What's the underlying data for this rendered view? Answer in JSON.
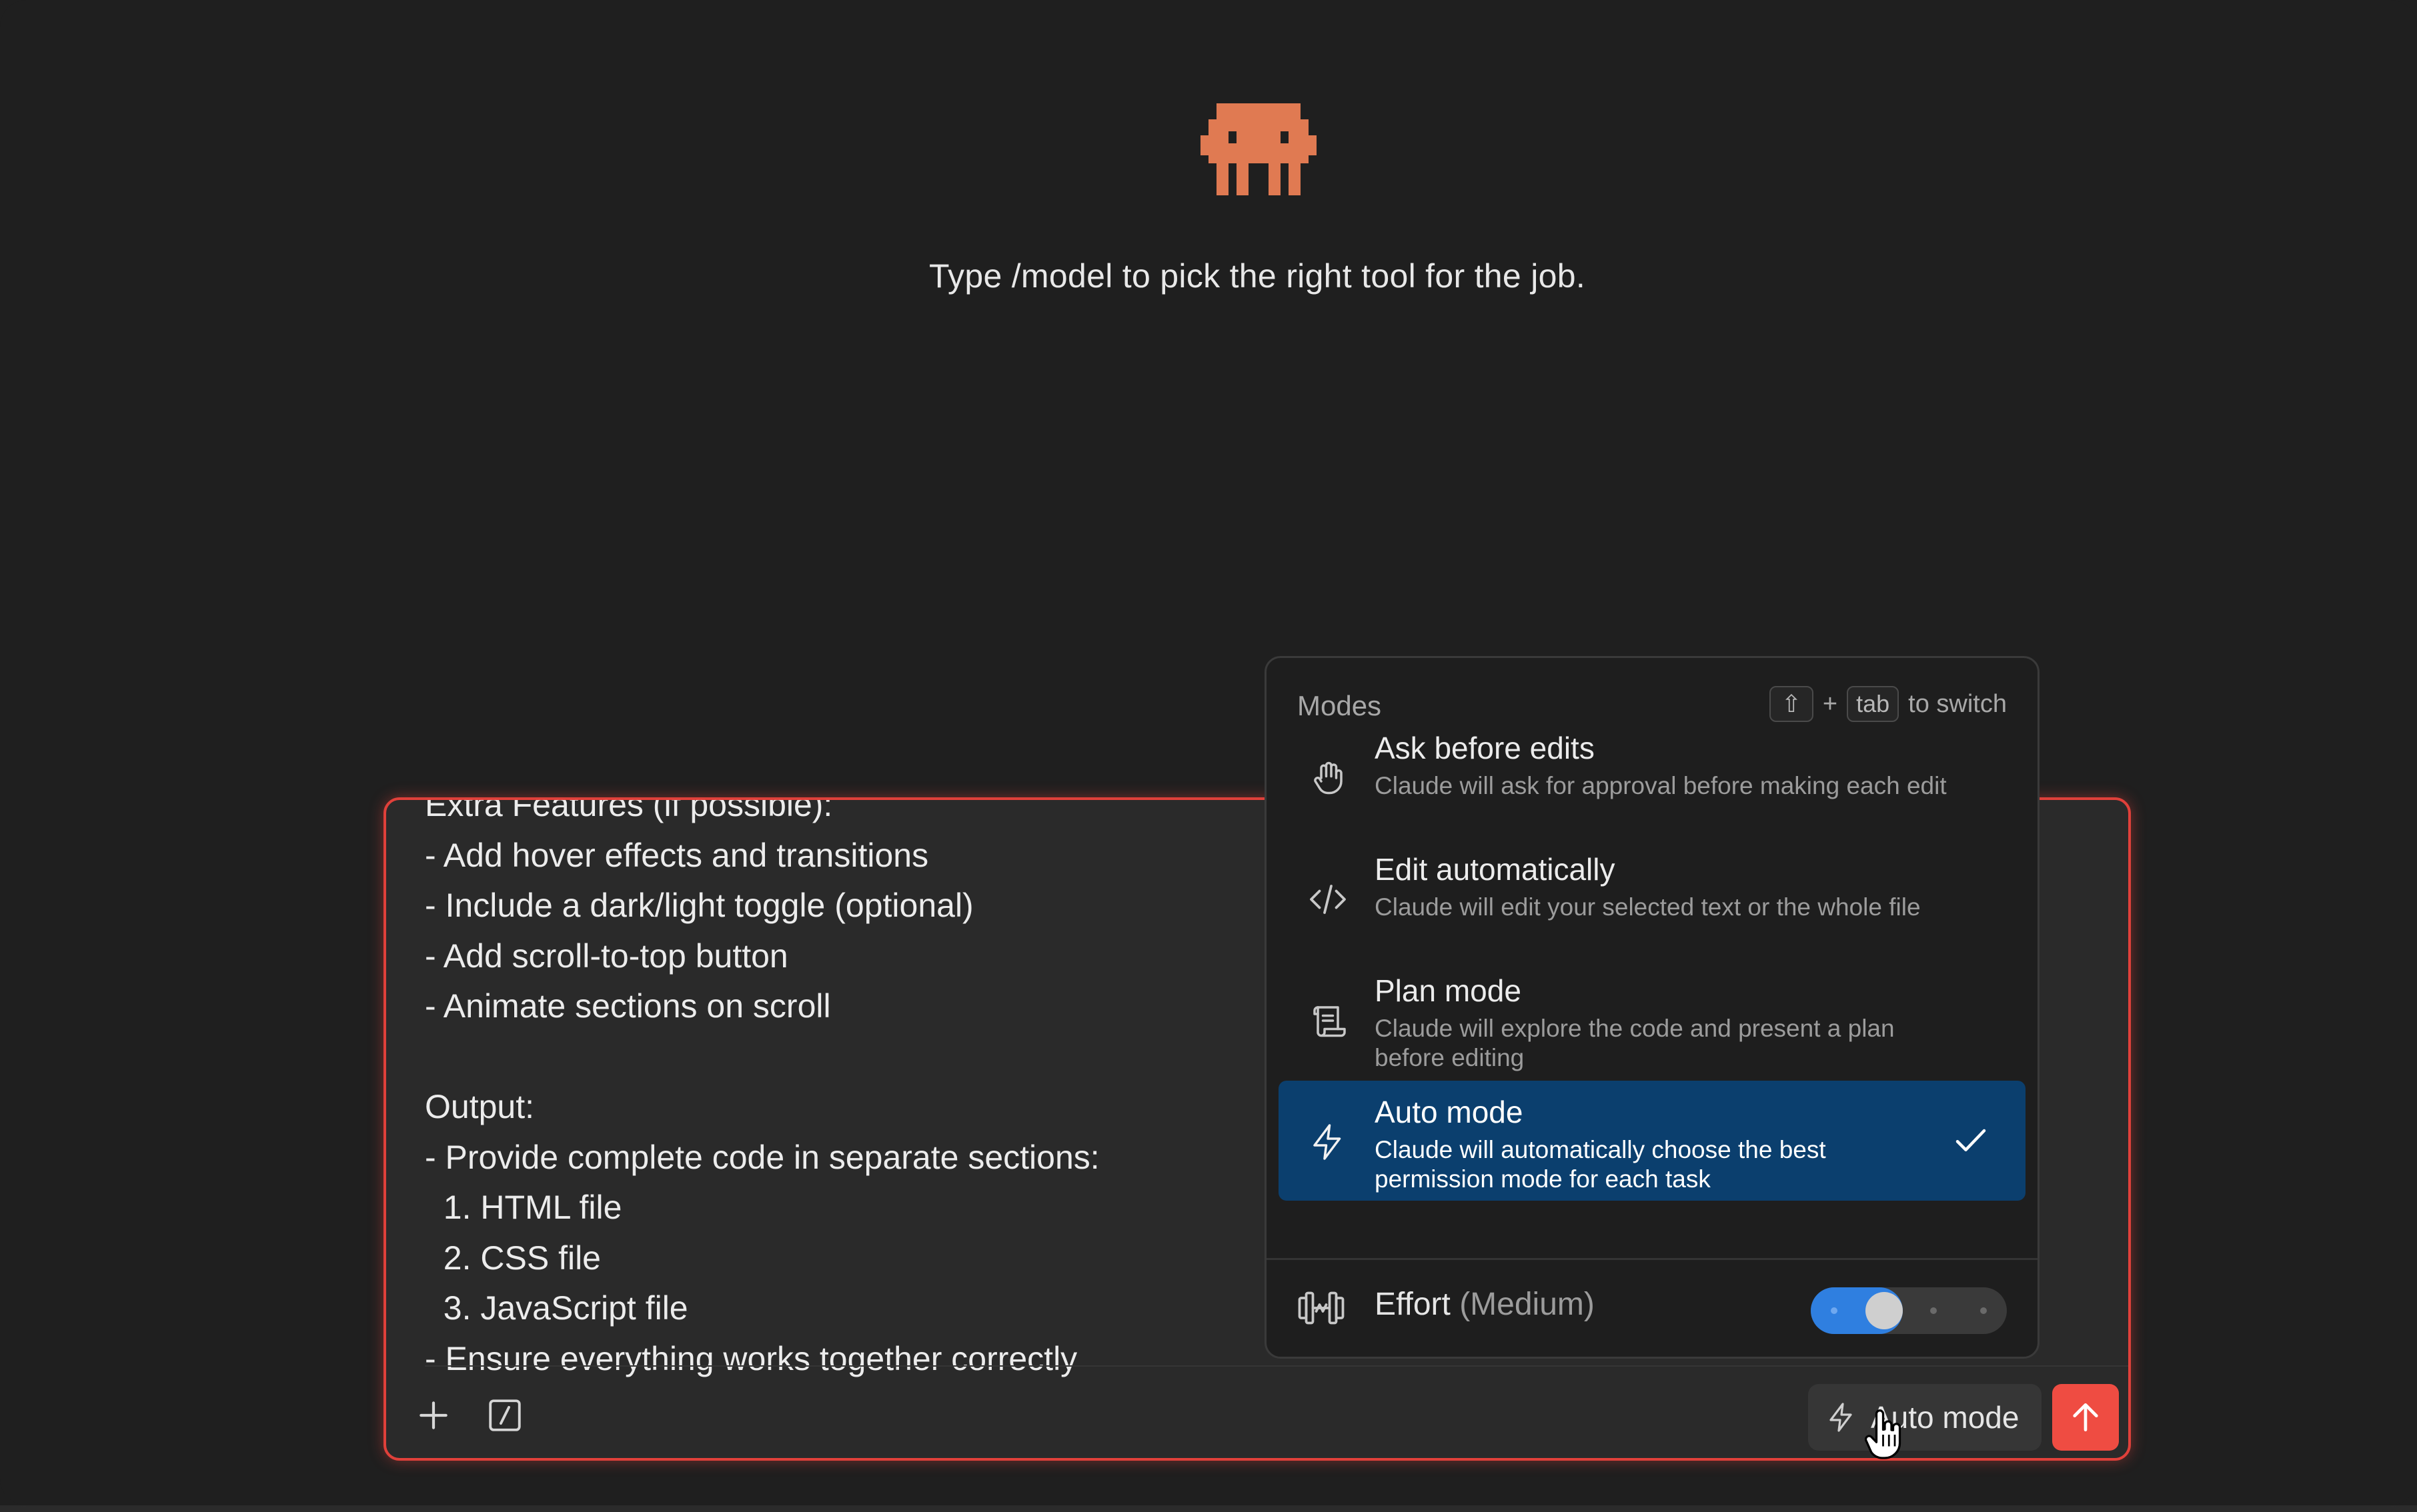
{
  "hero": {
    "tip": "Type /model to pick the right tool for the job."
  },
  "composer": {
    "text_lines": [
      "Extra Features (if possible):",
      "- Add hover effects and transitions",
      "- Include a dark/light toggle (optional)",
      "- Add scroll-to-top button",
      "- Animate sections on scroll",
      "",
      "Output:",
      "- Provide complete code in separate sections:",
      "  1. HTML file",
      "  2. CSS file",
      "  3. JavaScript file",
      "- Ensure everything works together correctly"
    ],
    "mode_button_label": "Auto mode"
  },
  "modes": {
    "title": "Modes",
    "hint_shift_key": "⇧",
    "hint_plus": "+",
    "hint_tab_key": "tab",
    "hint_suffix": "to switch",
    "items": [
      {
        "name": "Ask before edits",
        "desc": "Claude will ask for approval before making each edit",
        "icon": "hand-icon",
        "selected": false
      },
      {
        "name": "Edit automatically",
        "desc": "Claude will edit your selected text or the whole file",
        "icon": "code-icon",
        "selected": false
      },
      {
        "name": "Plan mode",
        "desc": "Claude will explore the code and present a plan before editing",
        "icon": "scroll-icon",
        "selected": false
      },
      {
        "name": "Auto mode",
        "desc": "Claude will automatically choose the best permission mode for each task",
        "icon": "bolt-icon",
        "selected": true
      }
    ],
    "effort": {
      "label": "Effort",
      "level": "(Medium)",
      "level_index": 1,
      "level_count": 4
    }
  },
  "colors": {
    "accent_red": "#e0403a",
    "send_button": "#ef4c42",
    "selected_bg": "#0b3f6e",
    "slider_blue": "#2f7fe0",
    "mascot": "#e07a52"
  }
}
